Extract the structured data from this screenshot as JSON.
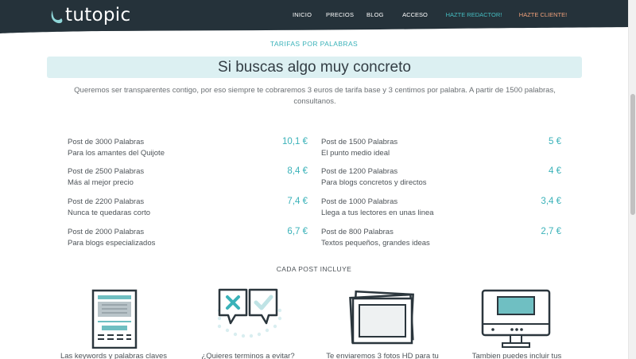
{
  "header": {
    "logo_text": "tutopic",
    "nav": [
      {
        "label": "INICIO"
      },
      {
        "label": "PRECIOS"
      },
      {
        "label": "BLOG"
      }
    ],
    "buttons": {
      "acceso": "ACCESO",
      "redactor": "HAZTE REDACTOR!",
      "cliente": "HAZTE CLIENTE!"
    }
  },
  "section": {
    "eyebrow": "TARIFAS POR PALABRAS",
    "title": "Si buscas algo muy concreto",
    "intro": "Queremos ser transparentes contigo, por eso siempre te cobraremos 3 euros de tarifa base y 3 centimos por palabra. A partir de 1500 palabras, consultanos."
  },
  "prices": {
    "left": [
      {
        "name": "Post de 3000 Palabras",
        "desc": "Para los amantes del Quijote",
        "price": "10,1 €"
      },
      {
        "name": "Post de 2500 Palabras",
        "desc": "Más al mejor precio",
        "price": "8,4 €"
      },
      {
        "name": "Post de 2200 Palabras",
        "desc": "Nunca te quedaras corto",
        "price": "7,4 €"
      },
      {
        "name": "Post de 2000 Palabras",
        "desc": "Para blogs especializados",
        "price": "6,7 €"
      }
    ],
    "right": [
      {
        "name": "Post de 1500 Palabras",
        "desc": "El punto medio ideal",
        "price": "5 €"
      },
      {
        "name": "Post de 1200 Palabras",
        "desc": "Para blogs concretos y directos",
        "price": "4 €"
      },
      {
        "name": "Post de 1000 Palabras",
        "desc": "Llega a tus lectores en unas linea",
        "price": "3,4 €"
      },
      {
        "name": "Post de 800 Palabras",
        "desc": "Textos pequeños, grandes ideas",
        "price": "2,7 €"
      }
    ]
  },
  "includes": {
    "title": "CADA POST INCLUYE",
    "features": [
      {
        "icon": "document-layout-icon",
        "caption": "Las keywords y palabras claves"
      },
      {
        "icon": "chat-bubbles-icon",
        "caption": "¿Quieres terminos a evitar?"
      },
      {
        "icon": "photos-stack-icon",
        "caption": "Te enviaremos 3 fotos HD para tu"
      },
      {
        "icon": "monitor-icon",
        "caption": "Tambien puedes incluir tus"
      }
    ]
  },
  "colors": {
    "accent": "#3ab2b9",
    "header_bg": "#25323a",
    "banner_bg": "#dcf0f2",
    "cliente_button_text": "#f0a07a"
  }
}
